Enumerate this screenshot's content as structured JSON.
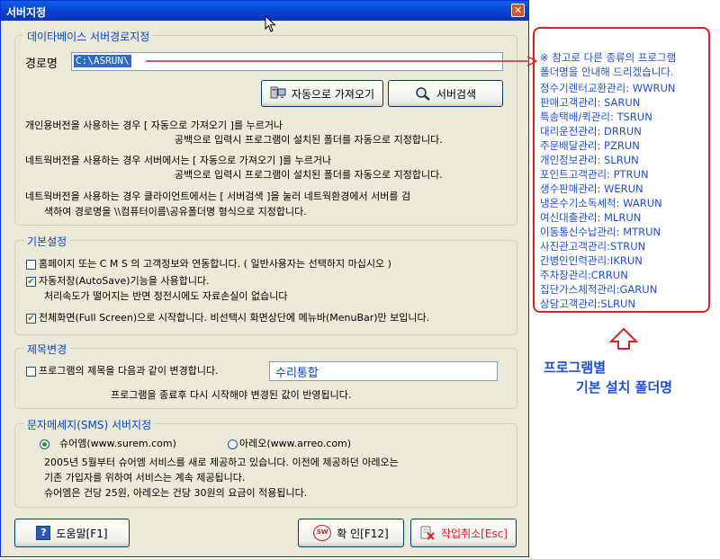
{
  "window": {
    "title": "서버지정",
    "close_glyph": "✕"
  },
  "db_group": {
    "label": "데이타베이스 서버경로지정",
    "path_label": "경로명",
    "path_value": "C:\\ASRUN\\",
    "auto_button": "자동으로 가져오기",
    "search_button": "서버검색",
    "desc1_l1": "개인용버전을 사용하는 경우 [ 자동으로 가져오기 ]를 누르거나",
    "desc1_l2": "공백으로 입력시 프로그램이 설치된 폴더를 자동으로 지정합니다.",
    "desc2_l1": "네트웍버전을 사용하는 경우 서버에서는 [ 자동으로 가져오기 ]를 누르거나",
    "desc2_l2": "공백으로 입력시 프로그램이 설치된 폴더를 자동으로 지정합니다.",
    "desc3_l1": "네트웍버전을 사용하는 경우 클라이언트에서는 [ 서버검색 ]을 눌러 네트웍환경에서 서버를 검",
    "desc3_l2": "색하여 경로명을 \\\\컴퓨터이름\\공유폴더명 형식으로 지정합니다."
  },
  "basic_group": {
    "label": "기본설정",
    "cms_label": "홈페이지 또는 C M S 의 고객정보와 연동합니다. ( 일반사용자는 선택하지 마십시오 )",
    "cms_checked": false,
    "autosave_label": "자동저장(AutoSave)기능을 사용합니다.",
    "autosave_note": "처리속도가 떨어지는 반면 정전시에도 자료손실이 없습니다",
    "autosave_checked": true,
    "fullscreen_label": "전체화면(Full Screen)으로 시작합니다. 비선택시 화면상단에 메뉴바(MenuBar)만 보입니다.",
    "fullscreen_checked": true,
    "check_glyph": "✔"
  },
  "title_group": {
    "label": "제목변경",
    "change_label": "프로그램의 제목을 다음과 같이 변경합니다.",
    "change_checked": false,
    "title_value": "수리통합",
    "note": "프로그램을 종료후 다시 시작해야 변경된 값이 반영됩니다."
  },
  "sms_group": {
    "label": "문자메세지(SMS) 서버지정",
    "option1": "슈어엠(www.surem.com)",
    "option1_selected": true,
    "option2": "아레오(www.arreo.com)",
    "option2_selected": false,
    "line1": "2005년 5월부터 슈어엠 서비스를 새로 제공하고 있습니다. 이전에 제공하던  아레오는",
    "line2": "기존 가입자를 위하여 서비스는 계속 제공됩니다.",
    "line3": "슈어엠은 건당 25원, 아레오는 건당 30원의 요금이 적용됩니다."
  },
  "footer": {
    "help_button": "도움말[F1]",
    "ok_button": "확 인[F12]",
    "cancel_button": "작업취소[Esc]",
    "help_icon_glyph": "?",
    "ok_icon_text": "SW"
  },
  "annotation": {
    "header_l1": "※ 참고로 다른 종류의 프로그램",
    "header_l2": "폴더명을 안내해 드리겠습니다.",
    "items": [
      "정수기렌터교환관리: WWRUN",
      "판매고객관리: SARUN",
      "특송택배/퀵관리: TSRUN",
      "대리운전관리: DRRUN",
      "주문배달관리: PZRUN",
      "개인정보관리: SLRUN",
      "포인트고객관리: PTRUN",
      "생수판매관리: WERUN",
      "냉온수기소독세척: WARUN",
      "여신대출관리: MLRUN",
      "이동통신수납관리: MTRUN",
      "사진관고객관리:STRUN",
      "간병인인력관리:IKRUN",
      "주차장관리:CRRUN",
      "집단가스체적관리:GARUN",
      "상담고객관리:SLRUN"
    ],
    "caption_l1": "프로그램별",
    "caption_l2": "기본 설치 폴더명"
  },
  "colors": {
    "accent": "#0046D5",
    "annotation": "#1E4FD0",
    "highlight": "#E02020"
  }
}
